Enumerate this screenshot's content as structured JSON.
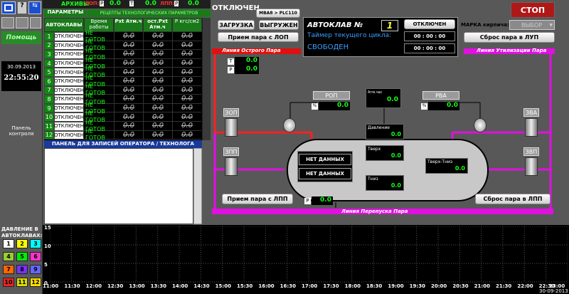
{
  "left": {
    "help_label": "Помощь",
    "date": "30.09.2013",
    "time": "22:55:20",
    "panel_label": "Панель контроля",
    "pressure_title": "ДАВЛЕНИЕ В АВТОКЛАВАХ:",
    "pressure_buttons": [
      {
        "label": "1",
        "color": "#ffffff"
      },
      {
        "label": "2",
        "color": "#ffff00"
      },
      {
        "label": "3",
        "color": "#00ffff"
      },
      {
        "label": "4",
        "color": "#99cc33"
      },
      {
        "label": "5",
        "color": "#00ee00"
      },
      {
        "label": "6",
        "color": "#ff33cc"
      },
      {
        "label": "7",
        "color": "#ff6600"
      },
      {
        "label": "8",
        "color": "#7733ff"
      },
      {
        "label": "9",
        "color": "#6666ff"
      },
      {
        "label": "10",
        "color": "#ee2222"
      },
      {
        "label": "11",
        "color": "#dddd00"
      },
      {
        "label": "12",
        "color": "#ffdd00"
      }
    ]
  },
  "topbar": {
    "archives": "АРХИВЫ",
    "lop": "ЛОП:",
    "p_tag": "P",
    "t_tag": "T",
    "lpp": "ЛПП:",
    "p_tag2": "P",
    "val1": "0.0",
    "val2": "0.0",
    "val3": "0.0",
    "tab_params": "ПАРАМЕТРЫ",
    "tab_recipes": "РЕЦЕПТЫ ТЕХНОЛОГИЧЕСКИХ ПАРАМЕТРОВ"
  },
  "table": {
    "headers": [
      "АВТОКЛАВЫ",
      "Время работы",
      "Pxt Атм.ч",
      "ост.Pxt Атм.ч",
      "P кгс/см2"
    ],
    "rows": [
      {
        "n": "1",
        "state": "ОТКЛЮЧЕН",
        "ready": "НЕ ГОТОВ",
        "v1": "0.0",
        "v2": "0.0",
        "v3": "0.0"
      },
      {
        "n": "2",
        "state": "ОТКЛЮЧЕН",
        "ready": "НЕ ГОТОВ",
        "v1": "0.0",
        "v2": "0.0",
        "v3": "0.0"
      },
      {
        "n": "3",
        "state": "ОТКЛЮЧЕН",
        "ready": "НЕ ГОТОВ",
        "v1": "0.0",
        "v2": "0.0",
        "v3": "0.0"
      },
      {
        "n": "4",
        "state": "ОТКЛЮЧЕН",
        "ready": "НЕ ГОТОВ",
        "v1": "0.0",
        "v2": "0.0",
        "v3": "0.0"
      },
      {
        "n": "5",
        "state": "ОТКЛЮЧЕН",
        "ready": "НЕ ГОТОВ",
        "v1": "0.0",
        "v2": "0.0",
        "v3": "0.0"
      },
      {
        "n": "6",
        "state": "ОТКЛЮЧЕН",
        "ready": "НЕ ГОТОВ",
        "v1": "0.0",
        "v2": "0.0",
        "v3": "0.0"
      },
      {
        "n": "7",
        "state": "ОТКЛЮЧЕН",
        "ready": "НЕ ГОТОВ",
        "v1": "0.0",
        "v2": "0.0",
        "v3": "0.0"
      },
      {
        "n": "8",
        "state": "ОТКЛЮЧЕН",
        "ready": "НЕ ГОТОВ",
        "v1": "0.0",
        "v2": "0.0",
        "v3": "0.0"
      },
      {
        "n": "9",
        "state": "ОТКЛЮЧЕН",
        "ready": "НЕ ГОТОВ",
        "v1": "0.0",
        "v2": "0.0",
        "v3": "0.0"
      },
      {
        "n": "10",
        "state": "ОТКЛЮЧЕН",
        "ready": "НЕ ГОТОВ",
        "v1": "0.0",
        "v2": "0.0",
        "v3": "0.0"
      },
      {
        "n": "11",
        "state": "ОТКЛЮЧЕН",
        "ready": "НЕ ГОТОВ",
        "v1": "0.0",
        "v2": "0.0",
        "v3": "0.0"
      },
      {
        "n": "12",
        "state": "ОТКЛЮЧЕН",
        "ready": "НЕ ГОТОВ",
        "v1": "0.0",
        "v2": "0.0",
        "v3": "0.0"
      }
    ],
    "notes_title": "ПАНЕЛЬ ДЛЯ ЗАПИСЕЙ ОПЕРАТОРА / ТЕХНОЛОГА"
  },
  "control": {
    "status": "ОТКЛЮЧЕН",
    "plc": "MBA8 > PLC110",
    "load": "ЗАГРУЗКА",
    "unload": "ВЫГРУЖЕН",
    "receive_lop": "Прием пара с ЛОП",
    "autoclave_label": "АВТОКЛАВ №",
    "autoclave_no": "1",
    "timer_label": "Таймер текущего цикла:",
    "free": "СВОБОДЕН",
    "state_box": "ОТКЛЮЧЕН",
    "t1": "00 : 00 : 00",
    "t2": "00 : 00 : 00",
    "brand_label": "МАРКА кирпича:",
    "brand_value": "ВЫБОР",
    "stop": "СТОП",
    "discharge_lup": "Сброс пара в ЛУП"
  },
  "scheme": {
    "line_hot": "Линия Острого Пара",
    "line_util": "Линия Утилизации Пара",
    "line_bypass": "Линия Перепуска Пара",
    "t_tag": "T",
    "p_tag": "P",
    "tv": "0.0",
    "pv": "0.0",
    "rop": "РОП",
    "rva": "РВА",
    "pct": "%",
    "rop_val": "0.0",
    "rva_val": "0.0",
    "atm_label": "Атм.час",
    "atm_val": "0.0",
    "zop": "ЗОП",
    "zpp": "ЗПП",
    "zva": "ЗВА",
    "zvp": "ЗВП",
    "pressure_lbl": "Давление",
    "pressure_val": "0.0",
    "no_data1": "НЕТ ДАННЫХ",
    "no_data2": "НЕТ ДАННЫХ",
    "tverh": "Tверх",
    "tverh_val": "0.0",
    "tniz": "Tниз",
    "tniz_val": "0.0",
    "tdiff": "Tверх-Tниз",
    "tdiff_val": "0.0",
    "receive_lpp": "Прием пара с ЛПП",
    "discharge_lpp": "Сброс пара в ЛПП",
    "p_low": "P",
    "p_low_val": "0.0"
  },
  "trend": {
    "y_labels": [
      "15",
      "10",
      "5",
      "0"
    ],
    "x_labels": [
      "11:00",
      "11:30",
      "12:00",
      "12:30",
      "13:00",
      "13:30",
      "14:00",
      "14:30",
      "15:00",
      "15:30",
      "16:00",
      "16:30",
      "17:00",
      "17:30",
      "18:00",
      "18:30",
      "19:00",
      "19:30",
      "20:00",
      "20:30",
      "21:00",
      "21:30",
      "22:00",
      "22:30",
      "23:00"
    ],
    "date": "30-09-2013"
  }
}
